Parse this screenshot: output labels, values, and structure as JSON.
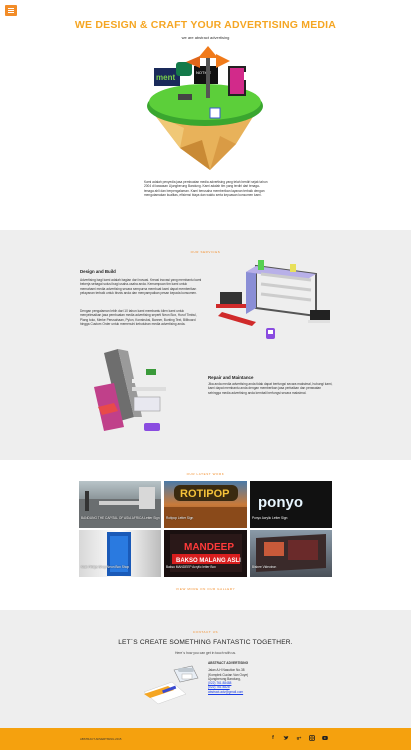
{
  "hero": {
    "title": "WE DESIGN & CRAFT YOUR ADVERTISING MEDIA",
    "subtitle": "we are abstract advertising",
    "description": "Kami adalah penyedia jasa pembuatan media advertising yang telah berdiri sejak tahun 2004 di kawasan Ujungberung Bandung. Kami adalah tim yang terdiri dari tenaga-tenaga ahli dan berpengalaman. Kami berusaha memberikan layanan terbaik dengan mengutamakan kualitas, efisiensi biaya dan waktu serta kepuasan konsumen kami."
  },
  "services": {
    "kicker": "OUR SERVICES",
    "design_build": {
      "title": "Design and Build",
      "p1": "Advertising bagi kami adalah bagian dari inovasi. Kreasi inovasi yang membantu kami bekerja sebagai solusi bagi usaha-usaha anda. Kemampuan tim kami untuk memahami media advertising secara sempurna membuat kami dapat memberikan pelayanan terbaik untuk bisnis anda dan menyampaikan pesan kepada konsumen.",
      "p2": "Dengan pengalaman lebih dari 10 tahun kami membantu klien kami untuk menyelesaikan jasa pembuatan media advertising seperti Neon Box, Huruf Timbul, Plang toko, Merke Perusahaan, Pylon, Konstruksi, Banner, Bunting Text, Billboard hingga Custom Order untuk memenuhi kebutuhan media advertising anda."
    },
    "repair": {
      "title": "Repair and Maintance",
      "body": "Jika anda media advertising anda tidak dapat berfungsi secara maksimal, hubungi kami, kami dapat membantu anda dengan memberikan jasa perbaikan dan perawatan sehingga media advertising anda kembali berfungsi secara maksimal."
    }
  },
  "work": {
    "kicker": "OUR LATEST WORK",
    "items": [
      {
        "caption": "BANDUNG THE CAPITAL OF ASIA AFRICA Letter Sign"
      },
      {
        "caption": "Rotipop Letter Sign"
      },
      {
        "caption": "Ponyo Acrylic Letter Sign"
      },
      {
        "caption": "Klub Philips Shop Neon Box Shop"
      },
      {
        "caption": "Bakso MANDEEP Acrylic letter Box"
      },
      {
        "caption": "Bisbee Videotron"
      }
    ],
    "gallery_link": "VIEW MORE ON OUR GALLERY"
  },
  "contact": {
    "kicker": "CONTACT US",
    "title": "LET`S CREATE SOMETHING FANTASTIC TOGETHER.",
    "subtitle": "Here`s how you can get in touch with us.",
    "company": "ABSTRACT ADVERTISING",
    "address_lines": [
      "Jalan A.H Nasution No.38",
      "(Komplek Cucian Van Ooye)",
      "Ujungberung Bandung,"
    ],
    "phone1": "(022) 761 88488",
    "phone2": "(022) 761 8828",
    "email": "abstract.adv@gmail.com"
  },
  "footer": {
    "copyright": "ABSTRACT ADVERTISING 2015",
    "socials": [
      "facebook-icon",
      "twitter-icon",
      "google-plus-icon",
      "instagram-icon",
      "youtube-icon"
    ]
  },
  "colors": {
    "accent": "#f5a623",
    "footer": "#f5a10e",
    "section_gray": "#eeeeee"
  }
}
